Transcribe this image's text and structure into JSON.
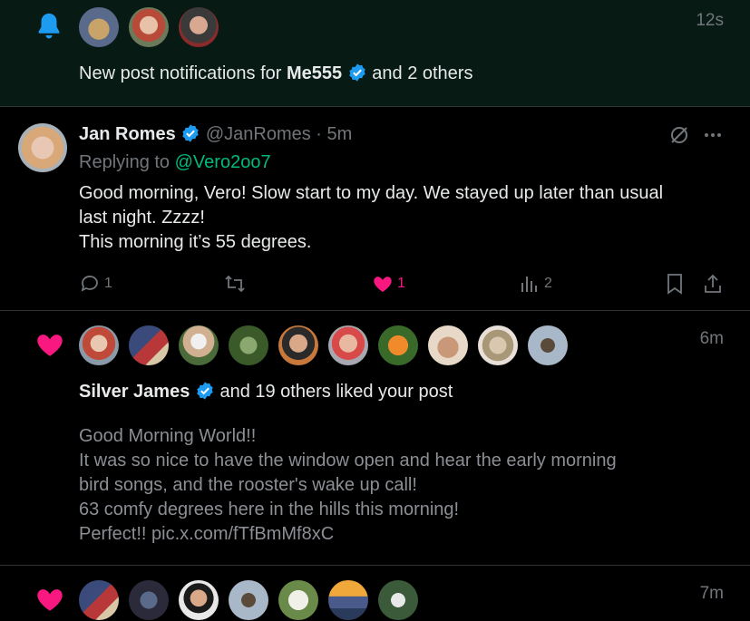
{
  "notification_top": {
    "time": "12s",
    "text_prefix": "New post notifications for ",
    "user": "Me555",
    "text_suffix": " and 2 others"
  },
  "tweet": {
    "name": "Jan Romes",
    "handle": "@JanRomes",
    "separator": " · ",
    "time": "5m",
    "replying_prefix": "Replying to ",
    "replying_to": "@Vero2oo7",
    "lines": [
      "Good morning, Vero! Slow start to my day. We stayed up later than usual",
      "last night. Zzzz!",
      "This morning it’s 55 degrees."
    ],
    "replies": "1",
    "likes": "1",
    "views": "2",
    "colors": {
      "like": "#f91880",
      "link": "#00ba7c",
      "verified": "#1d9bf0"
    }
  },
  "notification_like1": {
    "time": "6m",
    "user": "Silver James",
    "text_suffix": " and 19 others liked your post",
    "post_lines": [
      "Good Morning World!!",
      "It was so nice to have the window open and hear the early morning",
      "bird songs, and the rooster's wake up call!",
      "63 comfy degrees here in the hills this morning!",
      "Perfect!! pic.x.com/fTfBmMf8xC"
    ]
  },
  "notification_like2": {
    "time": "7m"
  }
}
